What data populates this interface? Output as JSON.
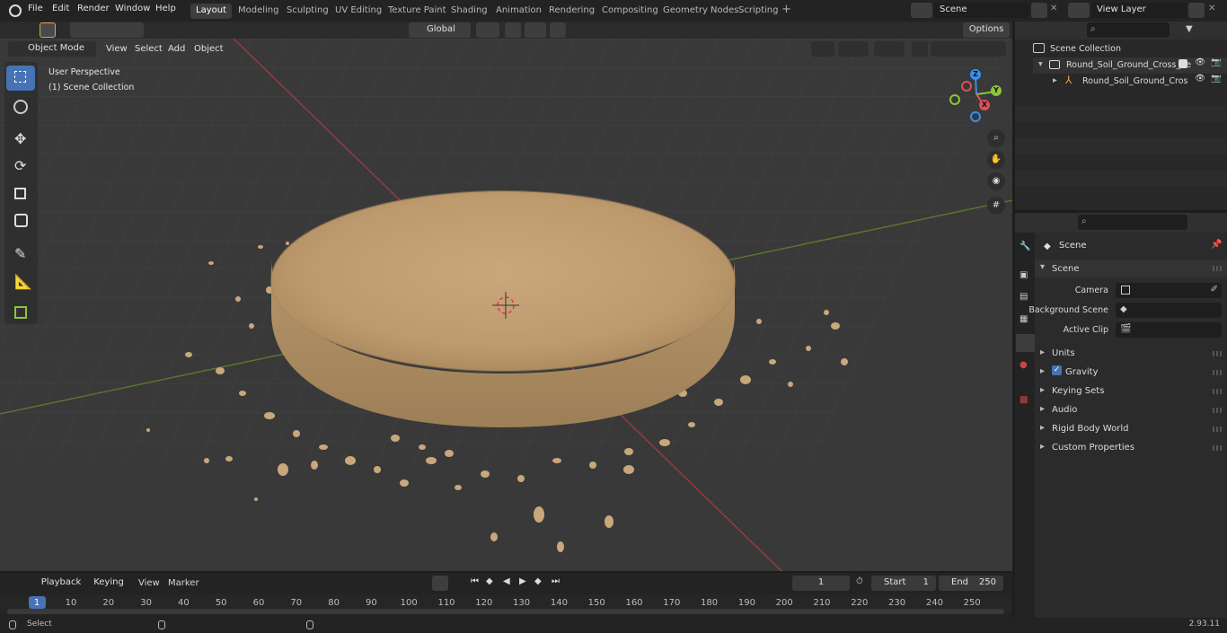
{
  "menu": {
    "items": [
      "File",
      "Edit",
      "Render",
      "Window",
      "Help"
    ]
  },
  "workspaces": [
    "Layout",
    "Modeling",
    "Sculpting",
    "UV Editing",
    "Texture Paint",
    "Shading",
    "Animation",
    "Rendering",
    "Compositing",
    "Geometry Nodes",
    "Scripting"
  ],
  "scene": {
    "name": "Scene"
  },
  "view_layer": {
    "name": "View Layer"
  },
  "header": {
    "orientation": "Global",
    "options": "Options",
    "mode": "Object Mode",
    "menus": [
      "View",
      "Select",
      "Add",
      "Object"
    ]
  },
  "viewport": {
    "perspective": "User Perspective",
    "collection": "(1) Scene Collection"
  },
  "gizmo": {
    "x": "X",
    "y": "Y",
    "z": "Z"
  },
  "outliner": {
    "root": "Scene Collection",
    "collection": "Round_Soil_Ground_Cross_Se",
    "object": "Round_Soil_Ground_Cros"
  },
  "properties": {
    "header": "Scene",
    "panel": "Scene",
    "camera_label": "Camera",
    "bg_scene_label": "Background Scene",
    "active_clip_label": "Active Clip",
    "sections": [
      "Units",
      "Gravity",
      "Keying Sets",
      "Audio",
      "Rigid Body World",
      "Custom Properties"
    ],
    "gravity_checked": true
  },
  "timeline": {
    "menus": [
      "Playback",
      "Keying",
      "View",
      "Marker"
    ],
    "current_frame": "1",
    "start_label": "Start",
    "start": "1",
    "end_label": "End",
    "end": "250",
    "ticks": [
      "1",
      "10",
      "20",
      "30",
      "40",
      "50",
      "60",
      "70",
      "80",
      "90",
      "100",
      "110",
      "120",
      "130",
      "140",
      "150",
      "160",
      "170",
      "180",
      "190",
      "200",
      "210",
      "220",
      "230",
      "240",
      "250"
    ]
  },
  "status": {
    "left": "Select",
    "version": "2.93.11"
  },
  "colors": {
    "accent": "#4772b3",
    "x_axis": "#e04e5a",
    "y_axis": "#8cc43c",
    "z_axis": "#3b8fe8",
    "soil": "#c9a77c"
  }
}
